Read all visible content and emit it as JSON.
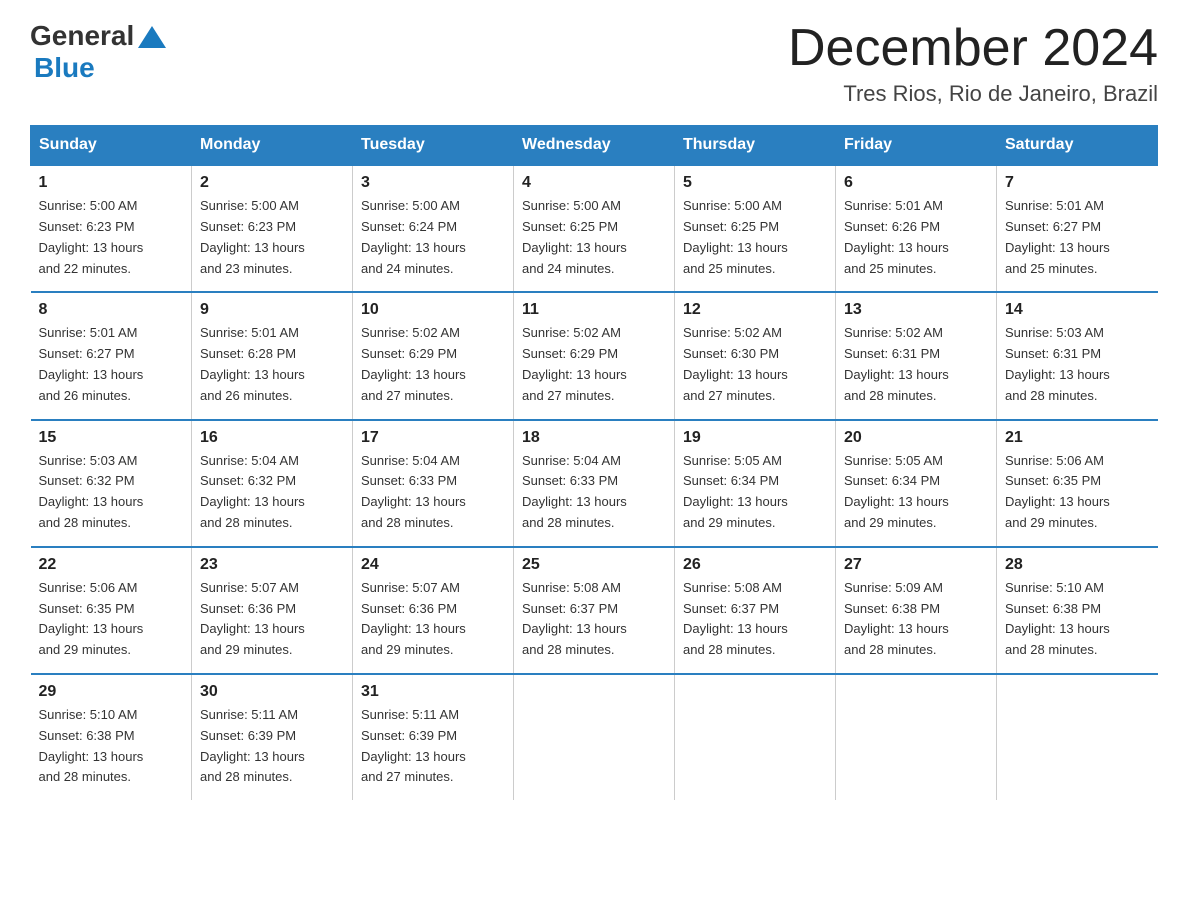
{
  "logo": {
    "general": "General",
    "blue": "Blue"
  },
  "title": "December 2024",
  "location": "Tres Rios, Rio de Janeiro, Brazil",
  "days_of_week": [
    "Sunday",
    "Monday",
    "Tuesday",
    "Wednesday",
    "Thursday",
    "Friday",
    "Saturday"
  ],
  "weeks": [
    [
      {
        "day": "1",
        "sunrise": "5:00 AM",
        "sunset": "6:23 PM",
        "daylight": "13 hours and 22 minutes."
      },
      {
        "day": "2",
        "sunrise": "5:00 AM",
        "sunset": "6:23 PM",
        "daylight": "13 hours and 23 minutes."
      },
      {
        "day": "3",
        "sunrise": "5:00 AM",
        "sunset": "6:24 PM",
        "daylight": "13 hours and 24 minutes."
      },
      {
        "day": "4",
        "sunrise": "5:00 AM",
        "sunset": "6:25 PM",
        "daylight": "13 hours and 24 minutes."
      },
      {
        "day": "5",
        "sunrise": "5:00 AM",
        "sunset": "6:25 PM",
        "daylight": "13 hours and 25 minutes."
      },
      {
        "day": "6",
        "sunrise": "5:01 AM",
        "sunset": "6:26 PM",
        "daylight": "13 hours and 25 minutes."
      },
      {
        "day": "7",
        "sunrise": "5:01 AM",
        "sunset": "6:27 PM",
        "daylight": "13 hours and 25 minutes."
      }
    ],
    [
      {
        "day": "8",
        "sunrise": "5:01 AM",
        "sunset": "6:27 PM",
        "daylight": "13 hours and 26 minutes."
      },
      {
        "day": "9",
        "sunrise": "5:01 AM",
        "sunset": "6:28 PM",
        "daylight": "13 hours and 26 minutes."
      },
      {
        "day": "10",
        "sunrise": "5:02 AM",
        "sunset": "6:29 PM",
        "daylight": "13 hours and 27 minutes."
      },
      {
        "day": "11",
        "sunrise": "5:02 AM",
        "sunset": "6:29 PM",
        "daylight": "13 hours and 27 minutes."
      },
      {
        "day": "12",
        "sunrise": "5:02 AM",
        "sunset": "6:30 PM",
        "daylight": "13 hours and 27 minutes."
      },
      {
        "day": "13",
        "sunrise": "5:02 AM",
        "sunset": "6:31 PM",
        "daylight": "13 hours and 28 minutes."
      },
      {
        "day": "14",
        "sunrise": "5:03 AM",
        "sunset": "6:31 PM",
        "daylight": "13 hours and 28 minutes."
      }
    ],
    [
      {
        "day": "15",
        "sunrise": "5:03 AM",
        "sunset": "6:32 PM",
        "daylight": "13 hours and 28 minutes."
      },
      {
        "day": "16",
        "sunrise": "5:04 AM",
        "sunset": "6:32 PM",
        "daylight": "13 hours and 28 minutes."
      },
      {
        "day": "17",
        "sunrise": "5:04 AM",
        "sunset": "6:33 PM",
        "daylight": "13 hours and 28 minutes."
      },
      {
        "day": "18",
        "sunrise": "5:04 AM",
        "sunset": "6:33 PM",
        "daylight": "13 hours and 28 minutes."
      },
      {
        "day": "19",
        "sunrise": "5:05 AM",
        "sunset": "6:34 PM",
        "daylight": "13 hours and 29 minutes."
      },
      {
        "day": "20",
        "sunrise": "5:05 AM",
        "sunset": "6:34 PM",
        "daylight": "13 hours and 29 minutes."
      },
      {
        "day": "21",
        "sunrise": "5:06 AM",
        "sunset": "6:35 PM",
        "daylight": "13 hours and 29 minutes."
      }
    ],
    [
      {
        "day": "22",
        "sunrise": "5:06 AM",
        "sunset": "6:35 PM",
        "daylight": "13 hours and 29 minutes."
      },
      {
        "day": "23",
        "sunrise": "5:07 AM",
        "sunset": "6:36 PM",
        "daylight": "13 hours and 29 minutes."
      },
      {
        "day": "24",
        "sunrise": "5:07 AM",
        "sunset": "6:36 PM",
        "daylight": "13 hours and 29 minutes."
      },
      {
        "day": "25",
        "sunrise": "5:08 AM",
        "sunset": "6:37 PM",
        "daylight": "13 hours and 28 minutes."
      },
      {
        "day": "26",
        "sunrise": "5:08 AM",
        "sunset": "6:37 PM",
        "daylight": "13 hours and 28 minutes."
      },
      {
        "day": "27",
        "sunrise": "5:09 AM",
        "sunset": "6:38 PM",
        "daylight": "13 hours and 28 minutes."
      },
      {
        "day": "28",
        "sunrise": "5:10 AM",
        "sunset": "6:38 PM",
        "daylight": "13 hours and 28 minutes."
      }
    ],
    [
      {
        "day": "29",
        "sunrise": "5:10 AM",
        "sunset": "6:38 PM",
        "daylight": "13 hours and 28 minutes."
      },
      {
        "day": "30",
        "sunrise": "5:11 AM",
        "sunset": "6:39 PM",
        "daylight": "13 hours and 28 minutes."
      },
      {
        "day": "31",
        "sunrise": "5:11 AM",
        "sunset": "6:39 PM",
        "daylight": "13 hours and 27 minutes."
      },
      null,
      null,
      null,
      null
    ]
  ],
  "labels": {
    "sunrise": "Sunrise:",
    "sunset": "Sunset:",
    "daylight": "Daylight:"
  }
}
